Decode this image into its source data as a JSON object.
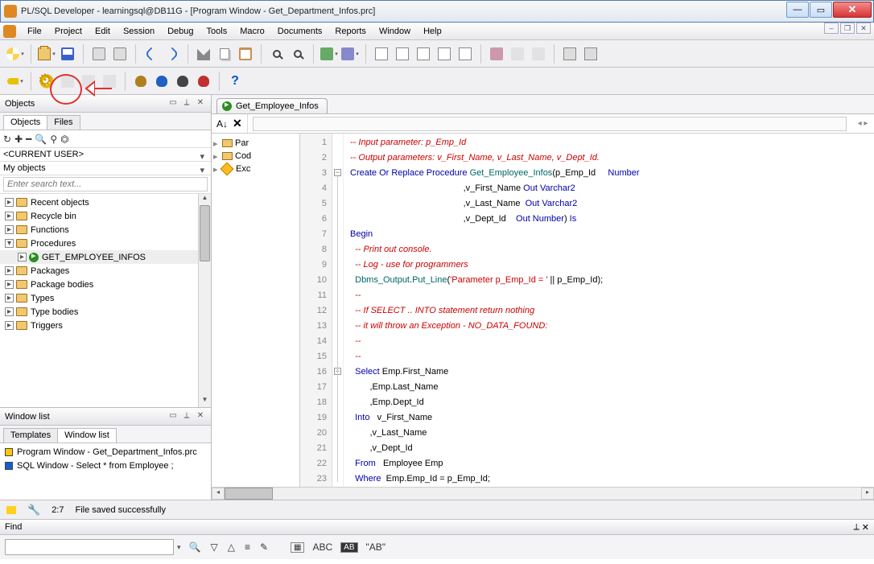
{
  "window": {
    "title": "PL/SQL Developer - learningsql@DB11G - [Program Window - Get_Department_Infos.prc]"
  },
  "menu": [
    "File",
    "Project",
    "Edit",
    "Session",
    "Debug",
    "Tools",
    "Macro",
    "Documents",
    "Reports",
    "Window",
    "Help"
  ],
  "objects_panel": {
    "title": "Objects",
    "tabs": [
      "Objects",
      "Files"
    ],
    "user_combo": "<CURRENT USER>",
    "filter_combo": "My objects",
    "search_placeholder": "Enter search text...",
    "tree": [
      {
        "label": "Recent objects",
        "type": "folder",
        "exp": "▹"
      },
      {
        "label": "Recycle bin",
        "type": "folder",
        "exp": "▹"
      },
      {
        "label": "Functions",
        "type": "folder",
        "exp": "▹"
      },
      {
        "label": "Procedures",
        "type": "folder",
        "exp": "▿",
        "expanded": true,
        "children": [
          {
            "label": "GET_EMPLOYEE_INFOS",
            "type": "proc",
            "selected": true
          }
        ]
      },
      {
        "label": "Packages",
        "type": "folder",
        "exp": "▹"
      },
      {
        "label": "Package bodies",
        "type": "folder",
        "exp": "▹"
      },
      {
        "label": "Types",
        "type": "folder",
        "exp": "▹"
      },
      {
        "label": "Type bodies",
        "type": "folder",
        "exp": "▹"
      },
      {
        "label": "Triggers",
        "type": "folder",
        "exp": "▹"
      }
    ]
  },
  "window_list": {
    "title": "Window list",
    "tabs": [
      "Templates",
      "Window list"
    ],
    "items": [
      {
        "color": "yellow",
        "label": "Program Window - Get_Department_Infos.prc"
      },
      {
        "color": "blue",
        "label": "SQL Window - Select * from Employee ;"
      }
    ]
  },
  "editor": {
    "tab_label": "Get_Employee_Infos",
    "nav_items": [
      {
        "icon": "folder",
        "label": "Par",
        "exp": "▹"
      },
      {
        "icon": "folder",
        "label": "Cod",
        "exp": "▹"
      },
      {
        "icon": "diamond",
        "label": "Exc",
        "exp": "▹"
      }
    ],
    "lines": [
      {
        "n": 1,
        "html": "<span class='cm'>-- Input parameter: p_Emp_Id</span>"
      },
      {
        "n": 2,
        "html": "<span class='cm'>-- Output parameters: v_First_Name, v_Last_Name, v_Dept_Id.</span>"
      },
      {
        "n": 3,
        "fold": "-",
        "html": "<span class='kw'>Create Or Replace Procedure</span> <span class='id'>Get_Employee_Infos</span>(p_Emp_Id     <span class='kw'>Number</span>"
      },
      {
        "n": 4,
        "html": "                                              ,v_First_Name <span class='kw'>Out Varchar2</span>"
      },
      {
        "n": 5,
        "html": "                                              ,v_Last_Name  <span class='kw'>Out Varchar2</span>"
      },
      {
        "n": 6,
        "html": "                                              ,v_Dept_Id    <span class='kw'>Out Number</span>) <span class='kw'>Is</span>"
      },
      {
        "n": 7,
        "html": "<span class='kw'>Begin</span>"
      },
      {
        "n": 8,
        "html": "  <span class='cm'>-- Print out console.</span>"
      },
      {
        "n": 9,
        "html": "  <span class='cm'>-- Log - use for programmers</span>"
      },
      {
        "n": 10,
        "html": "  <span class='id'>Dbms_Output</span>.<span class='id'>Put_Line</span>(<span class='str'>'Parameter p_Emp_Id = '</span> || p_Emp_Id);"
      },
      {
        "n": 11,
        "html": "  <span class='cm'>--</span>"
      },
      {
        "n": 12,
        "html": "  <span class='cm'>-- If SELECT .. INTO statement return nothing</span>"
      },
      {
        "n": 13,
        "html": "  <span class='cm'>-- it will throw an Exception - NO_DATA_FOUND:</span>"
      },
      {
        "n": 14,
        "html": "  <span class='cm'>--</span>"
      },
      {
        "n": 15,
        "html": "  <span class='cm'>--</span>"
      },
      {
        "n": 16,
        "fold": "-",
        "html": "  <span class='kw'>Select</span> Emp.First_Name"
      },
      {
        "n": 17,
        "html": "        ,Emp.Last_Name"
      },
      {
        "n": 18,
        "html": "        ,Emp.Dept_Id"
      },
      {
        "n": 19,
        "html": "  <span class='kw'>Into</span>   v_First_Name"
      },
      {
        "n": 20,
        "html": "        ,v_Last_Name"
      },
      {
        "n": 21,
        "html": "        ,v_Dept_Id"
      },
      {
        "n": 22,
        "html": "  <span class='kw'>From</span>   Employee Emp"
      },
      {
        "n": 23,
        "html": "  <span class='kw'>Where</span>  Emp.Emp_Id = p_Emp_Id;"
      }
    ]
  },
  "status": {
    "pos": "2:7",
    "msg": "File saved successfully"
  },
  "find": {
    "title": "Find",
    "ab_quoted": "\"AB\""
  }
}
